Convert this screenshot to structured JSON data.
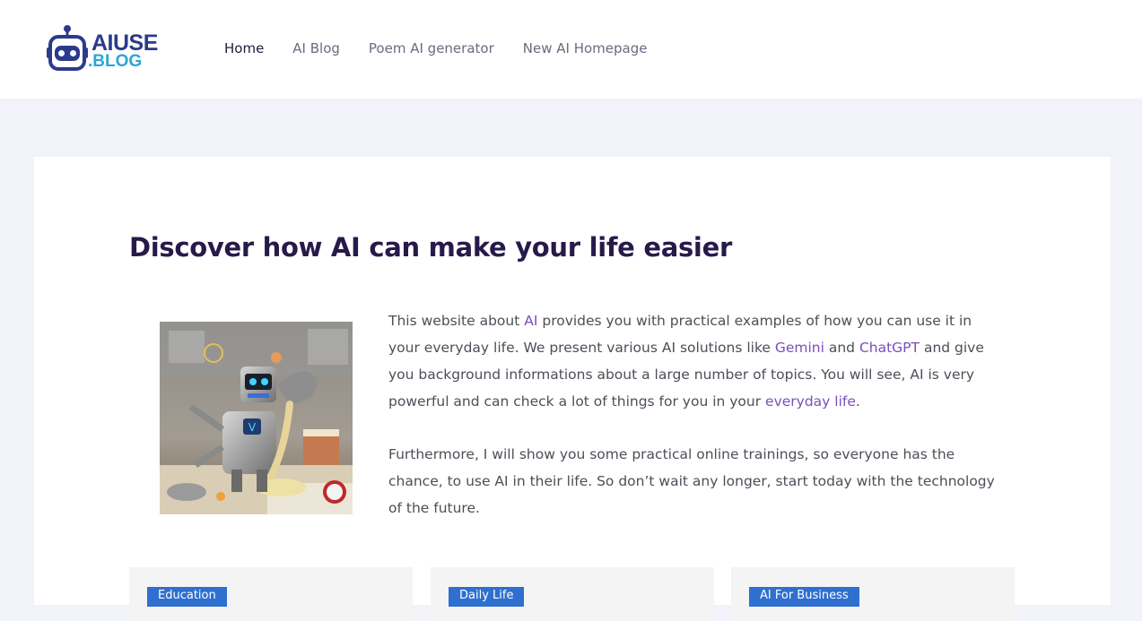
{
  "site": {
    "logo_line1": "AIUSE",
    "logo_line2": ".BLOG",
    "brand_color": "#2b3a8c",
    "accent_color": "#2aa7d6"
  },
  "nav": {
    "items": [
      {
        "label": "Home",
        "active": true
      },
      {
        "label": "AI Blog",
        "active": false
      },
      {
        "label": "Poem AI generator",
        "active": false
      },
      {
        "label": "New AI Homepage",
        "active": false
      }
    ]
  },
  "hero": {
    "title": "Discover how AI can make your life easier",
    "image_icon": "robot-baking-illustration"
  },
  "intro": {
    "p1_a": "This website about ",
    "p1_link1": "AI",
    "p1_b": " provides you with practical examples of how you can use it in your everyday life. We present various AI solutions like ",
    "p1_link2": "Gemini",
    "p1_c": " and ",
    "p1_link3": "ChatGPT",
    "p1_d": " and give you background informations about a large number of topics. You will see, AI is very powerful and can check a lot of things for you in your ",
    "p1_link4": "everyday life",
    "p1_e": ".",
    "p2": "Furthermore, I will show you some practical online trainings, so everyone has the chance, to use AI in their life. So don’t wait any longer, start today with the technology of the future."
  },
  "categories": [
    {
      "label": "Education"
    },
    {
      "label": "Daily Life"
    },
    {
      "label": "AI For Business"
    }
  ],
  "colors": {
    "link": "#7a4fb8",
    "badge": "#2f6fcf",
    "page_bg": "#f2f2fb"
  }
}
